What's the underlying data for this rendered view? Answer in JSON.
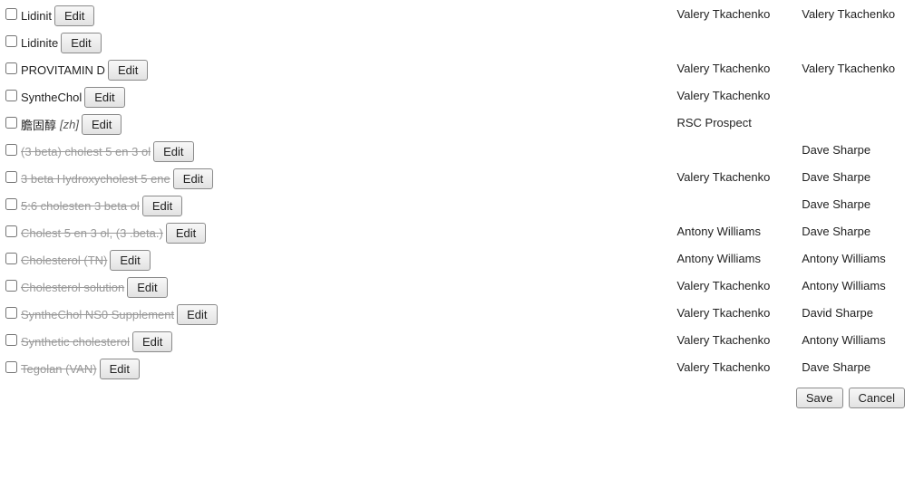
{
  "labels": {
    "edit": "Edit",
    "save": "Save",
    "cancel": "Cancel"
  },
  "rows": [
    {
      "name": "Lidinit",
      "lang": "",
      "struck": false,
      "col1": "Valery Tkachenko",
      "col2": "Valery Tkachenko"
    },
    {
      "name": "Lidinite",
      "lang": "",
      "struck": false,
      "col1": "",
      "col2": ""
    },
    {
      "name": "PROVITAMIN D",
      "lang": "",
      "struck": false,
      "col1": "Valery Tkachenko",
      "col2": "Valery Tkachenko"
    },
    {
      "name": "SyntheChol",
      "lang": "",
      "struck": false,
      "col1": "Valery Tkachenko",
      "col2": ""
    },
    {
      "name": "膽固醇",
      "lang": "[zh]",
      "struck": false,
      "col1": "RSC Prospect",
      "col2": ""
    },
    {
      "name": "(3 beta) cholest 5 en 3 ol",
      "lang": "",
      "struck": true,
      "col1": "",
      "col2": "Dave Sharpe"
    },
    {
      "name": "3 beta Hydroxycholest 5 ene",
      "lang": "",
      "struck": true,
      "col1": "Valery Tkachenko",
      "col2": "Dave Sharpe"
    },
    {
      "name": "5:6 cholesten 3 beta ol",
      "lang": "",
      "struck": true,
      "col1": "",
      "col2": "Dave Sharpe"
    },
    {
      "name": "Cholest 5 en 3 ol, (3 .beta.)",
      "lang": "",
      "struck": true,
      "col1": "Antony Williams",
      "col2": "Dave Sharpe"
    },
    {
      "name": "Cholesterol (TN)",
      "lang": "",
      "struck": true,
      "col1": "Antony Williams",
      "col2": "Antony Williams"
    },
    {
      "name": "Cholesterol solution",
      "lang": "",
      "struck": true,
      "col1": "Valery Tkachenko",
      "col2": "Antony Williams"
    },
    {
      "name": "SyntheChol NS0 Supplement",
      "lang": "",
      "struck": true,
      "col1": "Valery Tkachenko",
      "col2": "David Sharpe"
    },
    {
      "name": "Synthetic cholesterol",
      "lang": "",
      "struck": true,
      "col1": "Valery Tkachenko",
      "col2": "Antony Williams"
    },
    {
      "name": "Tegolan (VAN)",
      "lang": "",
      "struck": true,
      "col1": "Valery Tkachenko",
      "col2": "Dave Sharpe"
    }
  ]
}
